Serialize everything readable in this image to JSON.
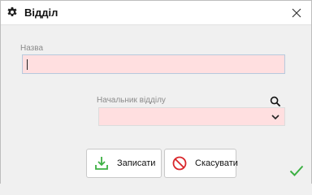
{
  "window": {
    "title": "Відділ",
    "title_icon": "gear-icon",
    "close_icon": "close-icon"
  },
  "form": {
    "name": {
      "label": "Назва",
      "value": ""
    },
    "department_head": {
      "label": "Начальник відділу",
      "value": "",
      "search_icon": "search-icon",
      "dropdown_icon": "chevron-down-icon"
    }
  },
  "buttons": {
    "save_label": "Записати",
    "save_icon": "download-icon",
    "cancel_label": "Скасувати",
    "cancel_icon": "prohibited-icon"
  },
  "status": {
    "icon": "checkmark-icon"
  },
  "colors": {
    "required_field_bg": "#ffdfe0",
    "accent_green": "#3cb043",
    "cancel_red": "#d9262b"
  }
}
